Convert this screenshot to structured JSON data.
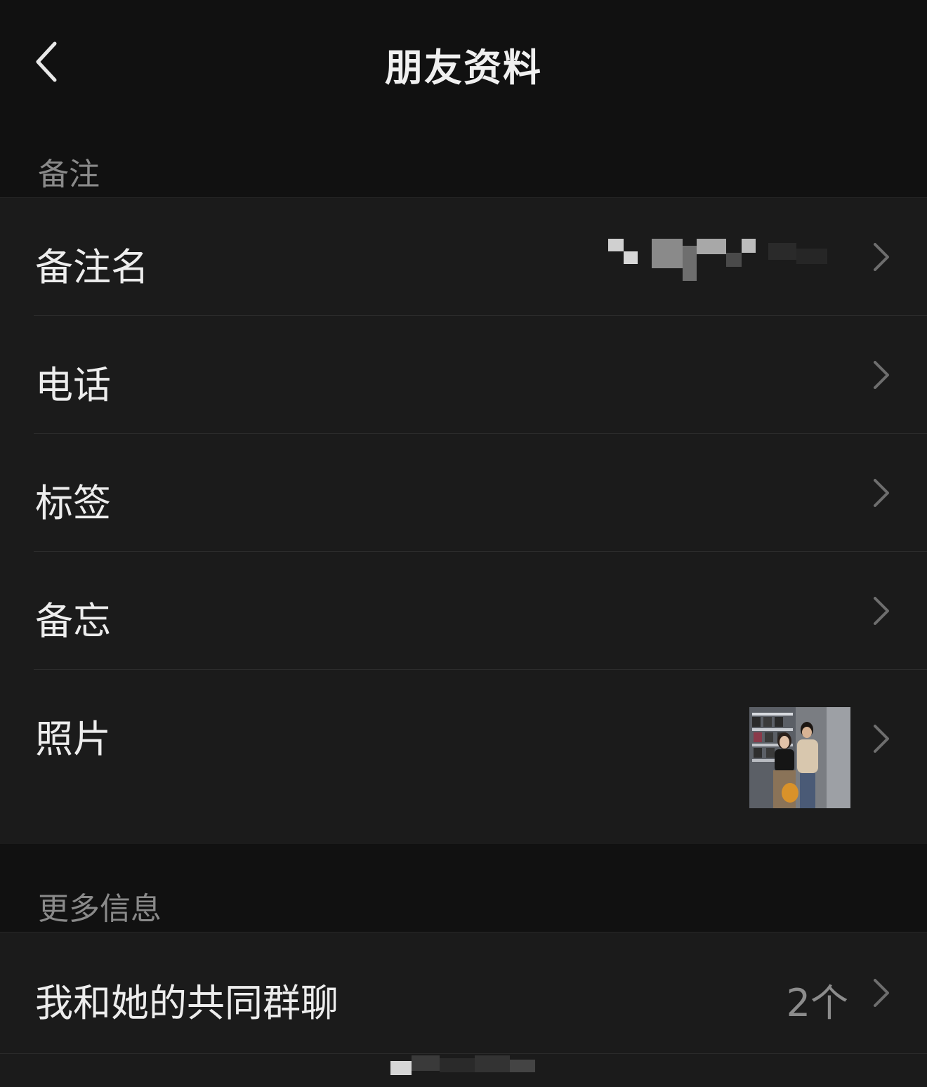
{
  "header": {
    "title": "朋友资料",
    "back_icon": "chevron-left-icon"
  },
  "sections": {
    "remark": {
      "label": "备注",
      "rows": [
        {
          "label": "备注名",
          "value": "",
          "value_obscured": true
        },
        {
          "label": "电话"
        },
        {
          "label": "标签"
        },
        {
          "label": "备忘"
        },
        {
          "label": "照片",
          "has_photo": true
        }
      ]
    },
    "more": {
      "label": "更多信息",
      "rows": [
        {
          "label": "我和她的共同群聊",
          "value": "2个"
        }
      ]
    }
  },
  "colors": {
    "background": "#111111",
    "row_background": "#1b1b1b",
    "primary_text": "#ededed",
    "secondary_text": "#8a8a8a",
    "chevron": "#6e6e6e"
  }
}
